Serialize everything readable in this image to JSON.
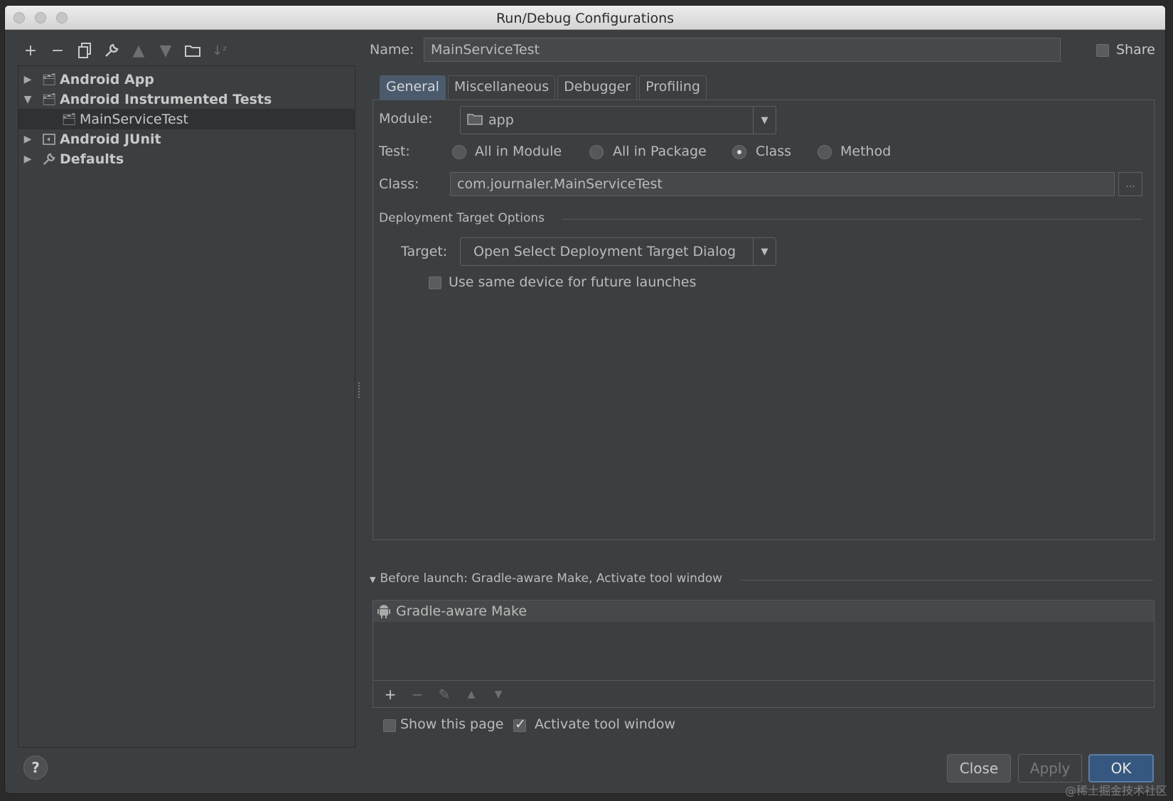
{
  "window": {
    "title": "Run/Debug Configurations"
  },
  "toolbar": {
    "icons": [
      "add-icon",
      "remove-icon",
      "copy-icon",
      "wrench-icon",
      "move-up-icon",
      "move-down-icon",
      "folder-icon",
      "sort-icon"
    ]
  },
  "tree": {
    "items": [
      {
        "label": "Android App",
        "expanded": false,
        "bold": true,
        "icon": "android-app-icon"
      },
      {
        "label": "Android Instrumented Tests",
        "expanded": true,
        "bold": true,
        "icon": "android-tests-icon"
      },
      {
        "label": "MainServiceTest",
        "selected": true,
        "bold": false,
        "icon": "test-config-icon"
      },
      {
        "label": "Android JUnit",
        "expanded": false,
        "bold": true,
        "icon": "junit-icon"
      },
      {
        "label": "Defaults",
        "expanded": false,
        "bold": true,
        "icon": "defaults-icon"
      }
    ]
  },
  "form": {
    "name_label": "Name:",
    "name_value": "MainServiceTest",
    "share_label": "Share",
    "tabs": [
      "General",
      "Miscellaneous",
      "Debugger",
      "Profiling"
    ],
    "active_tab": "General",
    "module_label": "Module:",
    "module_value": "app",
    "test_label": "Test:",
    "test_options": [
      "All in Module",
      "All in Package",
      "Class",
      "Method"
    ],
    "test_selected": "Class",
    "class_label": "Class:",
    "class_value": "com.journaler.MainServiceTest",
    "browse_label": "...",
    "deployment_header": "Deployment Target Options",
    "target_label": "Target:",
    "target_value": "Open Select Deployment Target Dialog",
    "same_device_label": "Use same device for future launches"
  },
  "before_launch": {
    "header": "Before launch: Gradle-aware Make, Activate tool window",
    "items": [
      "Gradle-aware Make"
    ],
    "show_page_label": "Show this page",
    "activate_label": "Activate tool window"
  },
  "footer": {
    "help_label": "?",
    "close_label": "Close",
    "apply_label": "Apply",
    "ok_label": "OK",
    "watermark": "@稀土掘金技术社区"
  }
}
